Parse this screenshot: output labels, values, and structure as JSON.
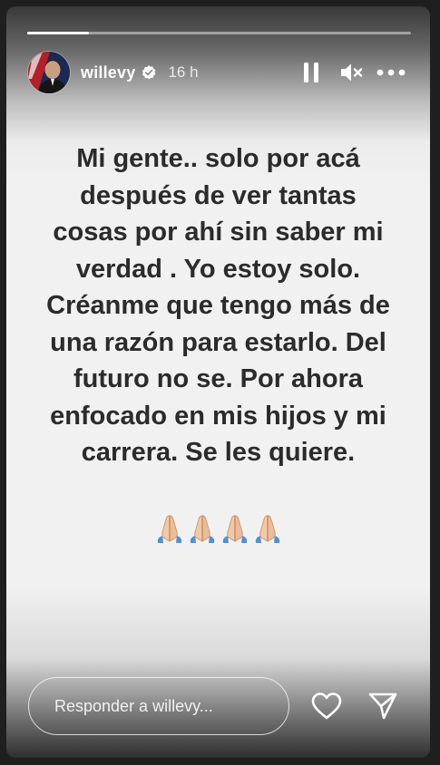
{
  "story": {
    "progress": 0.16
  },
  "header": {
    "username": "willevy",
    "time": "16 h",
    "verified_icon": "verified-badge-icon",
    "pause_icon": "pause-icon",
    "mute_icon": "speaker-muted-icon",
    "more_icon": "more-options-icon"
  },
  "content": {
    "text": "Mi gente.. solo por acá después de ver tantas cosas por ahí sin saber mi verdad . Yo estoy solo. Créanme que tengo más de una razón para estarlo. Del futuro no se. Por ahora enfocado en mis hijos y mi carrera. Se les quiere.",
    "emoji_icon": "folded-hands-icon",
    "emoji_count": 4
  },
  "footer": {
    "reply_placeholder": "Responder a willevy...",
    "like_icon": "heart-icon",
    "share_icon": "send-icon"
  }
}
